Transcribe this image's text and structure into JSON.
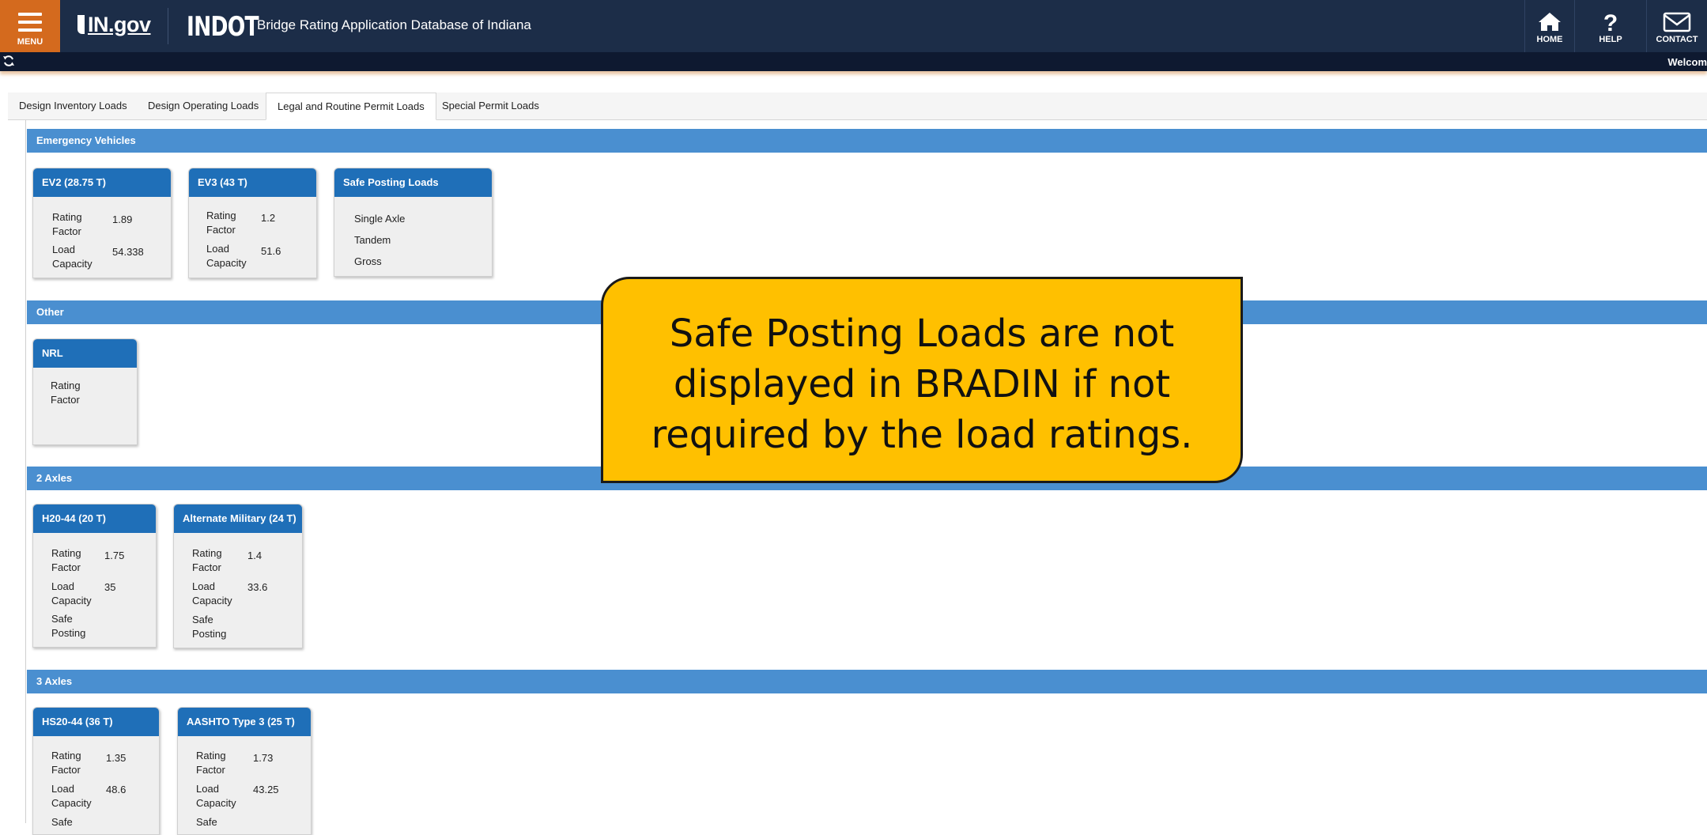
{
  "header": {
    "menu_label": "MENU",
    "portal_logo": "IN.gov",
    "agency": "INDOT",
    "app_title": "Bridge Rating Application Database of Indiana",
    "nav": [
      {
        "label": "HOME",
        "icon": "home-icon"
      },
      {
        "label": "HELP",
        "icon": "help-icon"
      },
      {
        "label": "CONTACT",
        "icon": "mail-icon"
      }
    ]
  },
  "subbar": {
    "refresh_icon": "refresh-icon",
    "welcome_text": "Welcom"
  },
  "tabs": [
    {
      "label": "Design Inventory Loads",
      "active": false
    },
    {
      "label": "Design Operating Loads",
      "active": false
    },
    {
      "label": "Legal and Routine Permit Loads",
      "active": true
    },
    {
      "label": "Special Permit Loads",
      "active": false
    }
  ],
  "sections": [
    {
      "title": "Emergency Vehicles",
      "cards": [
        {
          "title": "EV2 (28.75 T)",
          "rating_factor_label": "Rating Factor",
          "rating_factor": "1.89",
          "load_capacity_label": "Load Capacity",
          "load_capacity": "54.338"
        },
        {
          "title": "EV3 (43 T)",
          "rating_factor_label": "Rating Factor",
          "rating_factor": "1.2",
          "load_capacity_label": "Load Capacity",
          "load_capacity": "51.6"
        },
        {
          "title": "Safe Posting Loads",
          "rows": [
            "Single Axle",
            "Tandem",
            "Gross"
          ]
        }
      ]
    },
    {
      "title": "Other",
      "cards": [
        {
          "title": "NRL",
          "rating_factor_label": "Rating Factor"
        }
      ]
    },
    {
      "title": "2 Axles",
      "cards": [
        {
          "title": "H20-44 (20 T)",
          "rating_factor_label": "Rating Factor",
          "rating_factor": "1.75",
          "load_capacity_label": "Load Capacity",
          "load_capacity": "35",
          "safe_posting_label": "Safe Posting"
        },
        {
          "title": "Alternate Military (24 T)",
          "rating_factor_label": "Rating Factor",
          "rating_factor": "1.4",
          "load_capacity_label": "Load Capacity",
          "load_capacity": "33.6",
          "safe_posting_label": "Safe Posting"
        }
      ]
    },
    {
      "title": "3 Axles",
      "cards": [
        {
          "title": "HS20-44 (36 T)",
          "rating_factor_label": "Rating Factor",
          "rating_factor": "1.35",
          "load_capacity_label": "Load Capacity",
          "load_capacity": "48.6",
          "safe_posting_label": "Safe"
        },
        {
          "title": "AASHTO Type 3 (25 T)",
          "rating_factor_label": "Rating Factor",
          "rating_factor": "1.73",
          "load_capacity_label": "Load Capacity",
          "load_capacity": "43.25",
          "safe_posting_label": "Safe"
        }
      ]
    }
  ],
  "callout": {
    "text": "Safe Posting Loads are not displayed in BRADIN if not required by the load ratings.",
    "color": "#ffc000"
  },
  "colors": {
    "header_bg": "#1c2d48",
    "menu_bg": "#d46a1e",
    "section_bar": "#4a8fd0",
    "card_header": "#1f6fb8"
  }
}
